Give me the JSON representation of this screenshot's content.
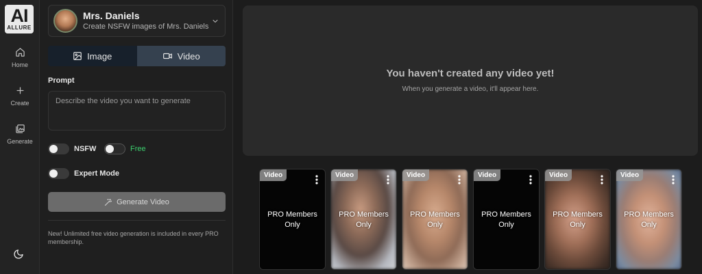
{
  "logo": {
    "mark": "AI",
    "word": "ALLURE"
  },
  "rail": {
    "items": [
      {
        "label": "Home",
        "icon": "home-icon"
      },
      {
        "label": "Create",
        "icon": "plus-icon"
      },
      {
        "label": "Generate",
        "icon": "gallery-icon"
      }
    ],
    "theme_icon": "moon-icon"
  },
  "character": {
    "name": "Mrs. Daniels",
    "subtitle": "Create NSFW images of Mrs. Daniels"
  },
  "tabs": [
    {
      "label": "Image",
      "icon": "image-icon",
      "active": false
    },
    {
      "label": "Video",
      "icon": "video-icon",
      "active": true
    }
  ],
  "prompt": {
    "label": "Prompt",
    "placeholder": "Describe the video you want to generate",
    "value": ""
  },
  "toggles": {
    "nsfw": {
      "label": "NSFW",
      "on": false
    },
    "free": {
      "label": "Free",
      "on": true,
      "color": "#3ccf6e"
    },
    "expert": {
      "label": "Expert Mode",
      "on": false
    }
  },
  "generate_button": {
    "label": "Generate Video"
  },
  "note": "New! Unlimited free video generation is included in every PRO membership.",
  "empty_state": {
    "title": "You haven't created any video yet!",
    "subtitle": "When you generate a video, it'll appear here."
  },
  "gallery": {
    "items": [
      {
        "badge": "Video",
        "text_line1": "PRO Members",
        "text_line2": "Only",
        "thumb": "black"
      },
      {
        "badge": "Video",
        "text_line1": "PRO Members",
        "text_line2": "Only",
        "thumb": "blurred"
      },
      {
        "badge": "Video",
        "text_line1": "PRO Members",
        "text_line2": "Only",
        "thumb": "blurred"
      },
      {
        "badge": "Video",
        "text_line1": "PRO Members",
        "text_line2": "Only",
        "thumb": "black"
      },
      {
        "badge": "Video",
        "text_line1": "PRO Members",
        "text_line2": "Only",
        "thumb": "blurred"
      },
      {
        "badge": "Video",
        "text_line1": "PRO Members",
        "text_line2": "Only",
        "thumb": "blurred"
      }
    ]
  }
}
